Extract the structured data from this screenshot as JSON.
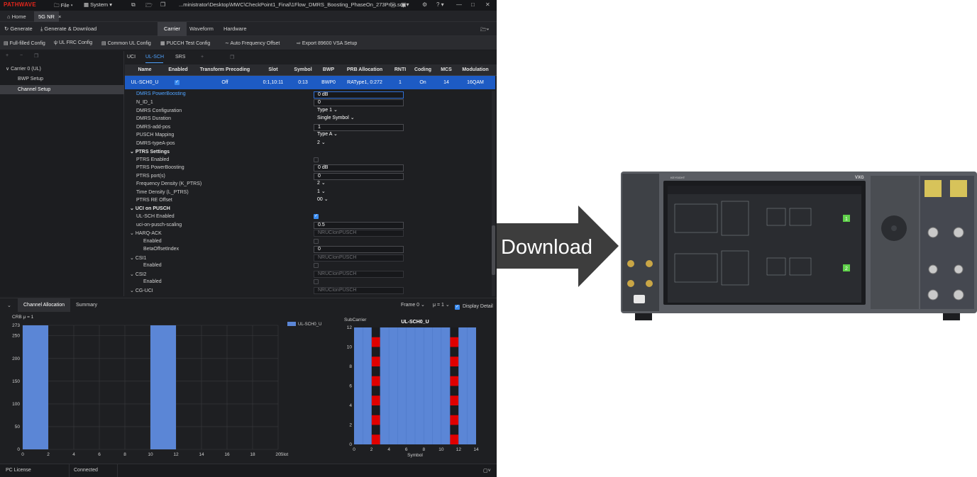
{
  "titlebar": {
    "logo": "PATHWAVE",
    "file_menu": "File",
    "system_menu": "System",
    "path": "...ministrator\\Desktop\\MWC\\CheckPoint1_Final\\1Flow_DMRS_Boosting_PhaseOn_273Prbs.scp",
    "help": "?"
  },
  "tabs": {
    "home": "Home",
    "active": "5G NR"
  },
  "toolbar": {
    "generate": "Generate",
    "generate_download": "Generate & Download",
    "ribbon": [
      "Carrier",
      "Waveform",
      "Hardware"
    ]
  },
  "configbar": [
    "Full-filled Config",
    "UL FRC Config",
    "Common UL Config",
    "PUCCH Test Config",
    "Auto Frequency Offset",
    "Export 89600 VSA Setup"
  ],
  "tree": {
    "carrier": "Carrier 0 (UL)",
    "bwp": "BWP Setup",
    "channel": "Channel Setup"
  },
  "subtabs": [
    "UCI",
    "UL-SCH",
    "SRS"
  ],
  "grid": {
    "headers": [
      "Name",
      "Enabled",
      "Transform Precoding",
      "Slot",
      "Symbol",
      "BWP",
      "PRB Allocation",
      "RNTI",
      "Coding",
      "MCS",
      "Modulation"
    ],
    "row": {
      "name": "UL-SCH0_U",
      "transform": "Off",
      "slot": "0:1,10:11",
      "symbol": "0:13",
      "bwp": "BWP0",
      "prb": "RAType1, 0:272",
      "rnti": "1",
      "coding": "On",
      "mcs": "14",
      "modulation": "16QAM"
    }
  },
  "props": {
    "dmrs_powerboosting": {
      "label": "DMRS PowerBoosting",
      "value": "0 dB"
    },
    "n_id_1": {
      "label": "N_ID_1",
      "value": "0"
    },
    "dmrs_configuration": {
      "label": "DMRS Configuration",
      "value": "Type 1"
    },
    "dmrs_duration": {
      "label": "DMRS Duration",
      "value": "Single Symbol"
    },
    "dmrs_add_pos": {
      "label": "DMRS-add-pos",
      "value": "1"
    },
    "pusch_mapping": {
      "label": "PUSCH Mapping",
      "value": "Type A"
    },
    "dmrs_typea_pos": {
      "label": "DMRS-typeA-pos",
      "value": "2"
    },
    "ptrs_settings": {
      "label": "PTRS Settings"
    },
    "ptrs_enabled": {
      "label": "PTRS Enabled"
    },
    "ptrs_powerboosting": {
      "label": "PTRS PowerBoosting",
      "value": "0 dB"
    },
    "ptrs_ports": {
      "label": "PTRS port(s)",
      "value": "0"
    },
    "freq_density": {
      "label": "Frequency Density (K_PTRS)",
      "value": "2"
    },
    "time_density": {
      "label": "Time Density (L_PTRS)",
      "value": "1"
    },
    "ptrs_re_offset": {
      "label": "PTRS RE Offset",
      "value": "00"
    },
    "uci_on_pusch": {
      "label": "UCI on PUSCH"
    },
    "ulsch_enabled": {
      "label": "UL-SCH Enabled"
    },
    "uci_scaling": {
      "label": "uci-on-pusch-scaling",
      "value": "0.5"
    },
    "harq_ack": {
      "label": "HARQ-ACK",
      "value": "NRUCIonPUSCH"
    },
    "harq_enabled": {
      "label": "Enabled"
    },
    "beta_offset": {
      "label": "BetaOffsetIndex",
      "value": "0"
    },
    "csi1": {
      "label": "CSI1",
      "value": "NRUCIonPUSCH"
    },
    "csi1_enabled": {
      "label": "Enabled"
    },
    "csi2": {
      "label": "CSI2",
      "value": "NRUCIonPUSCH"
    },
    "csi2_enabled": {
      "label": "Enabled"
    },
    "cg_uci": {
      "label": "CG-UCI",
      "value": "NRUCIonPUSCH"
    }
  },
  "bottom": {
    "tabs": [
      "Channel Allocation",
      "Summary"
    ],
    "frame": "Frame 0",
    "mu": "μ = 1",
    "display_detail": "Display Detail"
  },
  "chart_data": [
    {
      "type": "bar",
      "title": "",
      "corner_label": "CRB μ = 1",
      "xlabel": "Slot",
      "ylabel": "",
      "xlim": [
        0,
        20
      ],
      "ylim": [
        0,
        273
      ],
      "x_ticks": [
        0,
        2,
        4,
        6,
        8,
        10,
        12,
        14,
        16,
        18,
        20
      ],
      "y_ticks": [
        0,
        50,
        100,
        150,
        200,
        250,
        273
      ],
      "series": [
        {
          "name": "UL-SCH0_U",
          "color": "#5b86d6",
          "ranges": [
            [
              0,
              2
            ],
            [
              10,
              12
            ]
          ],
          "crb": [
            0,
            273
          ]
        }
      ],
      "grid": true,
      "legend": "top-right"
    },
    {
      "type": "heatmap",
      "title": "UL-SCH0_U",
      "ylabel": "SubCarrier",
      "xlabel": "Symbol",
      "xlim": [
        0,
        14
      ],
      "ylim": [
        0,
        12
      ],
      "x_ticks": [
        0,
        2,
        4,
        6,
        8,
        10,
        12,
        14
      ],
      "y_ticks": [
        0,
        2,
        4,
        6,
        8,
        10,
        12
      ],
      "data_color": "#5b86d6",
      "dmrs_color": "#e00000",
      "dmrs_symbols": [
        2,
        11
      ],
      "dmrs_subcarriers": [
        0,
        2,
        4,
        6,
        8,
        10
      ]
    }
  ],
  "statusbar": {
    "license": "PC License",
    "connection": "Connected"
  },
  "arrow": {
    "label": "Download"
  },
  "instrument": {
    "brand": "KEYSIGHT",
    "model": "VXG",
    "markers": [
      "1",
      "2"
    ]
  },
  "colors": {
    "accent": "#1d5bc4",
    "bar": "#5b86d6",
    "dmrs": "#e00000",
    "logo": "#e1261c"
  }
}
